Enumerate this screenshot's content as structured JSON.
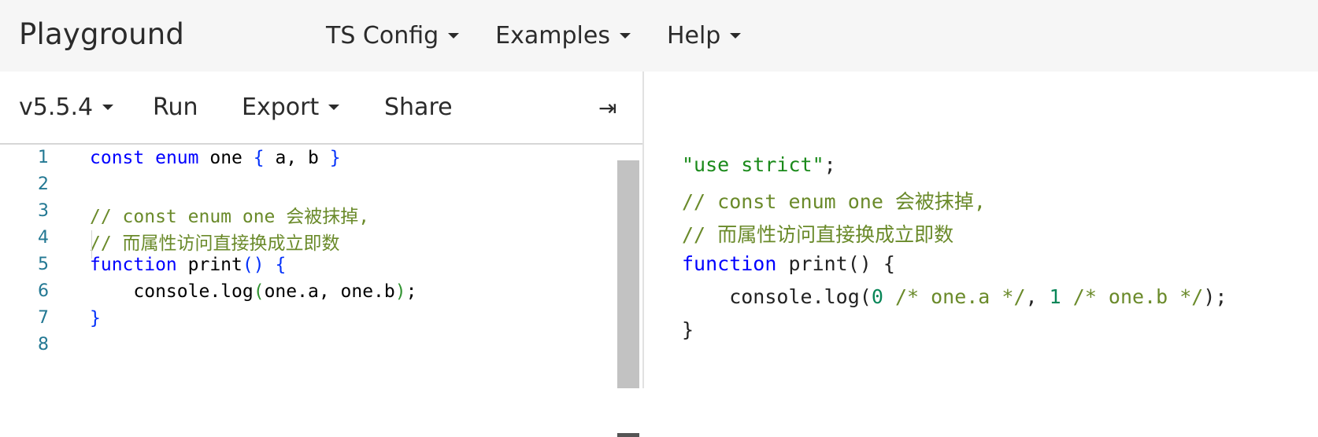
{
  "header": {
    "brand": "Playground",
    "nav": [
      {
        "label": "TS Config"
      },
      {
        "label": "Examples"
      },
      {
        "label": "Help"
      }
    ]
  },
  "toolbar": {
    "version": "v5.5.4",
    "run": "Run",
    "export": "Export",
    "share": "Share",
    "collapse_icon": "⇥"
  },
  "editor": {
    "line_numbers": [
      "1",
      "2",
      "3",
      "4",
      "5",
      "6",
      "7",
      "8"
    ],
    "lines": [
      {
        "tokens": [
          [
            "kw",
            "const"
          ],
          [
            "",
            " "
          ],
          [
            "kw",
            "enum"
          ],
          [
            "",
            " one "
          ],
          [
            "br",
            "{"
          ],
          [
            "",
            " a, b "
          ],
          [
            "br",
            "}"
          ]
        ]
      },
      {
        "tokens": []
      },
      {
        "tokens": [
          [
            "cm",
            "// const enum one 会被抹掉,"
          ]
        ]
      },
      {
        "tokens": [
          [
            "cm",
            "// 而属性访问直接换成立即数"
          ]
        ]
      },
      {
        "tokens": [
          [
            "kw",
            "function"
          ],
          [
            "",
            " print"
          ],
          [
            "br",
            "()"
          ],
          [
            "",
            " "
          ],
          [
            "br",
            "{"
          ]
        ]
      },
      {
        "tokens": [
          [
            "",
            "    console.log"
          ],
          [
            "br2",
            "("
          ],
          [
            "",
            "one.a, one.b"
          ],
          [
            "br2",
            ")"
          ],
          [
            "",
            ";"
          ]
        ]
      },
      {
        "tokens": [
          [
            "br",
            "}"
          ]
        ]
      },
      {
        "tokens": []
      }
    ]
  },
  "output": {
    "lines": [
      {
        "tokens": [
          [
            "str",
            "\"use strict\""
          ],
          [
            "",
            ";"
          ]
        ]
      },
      {
        "tokens": [
          [
            "ocm",
            "// const enum one 会被抹掉,"
          ]
        ]
      },
      {
        "tokens": [
          [
            "ocm",
            "// 而属性访问直接换成立即数"
          ]
        ]
      },
      {
        "tokens": [
          [
            "okw",
            "function"
          ],
          [
            "",
            " print() {"
          ]
        ]
      },
      {
        "tokens": [
          [
            "",
            "    console.log("
          ],
          [
            "num",
            "0"
          ],
          [
            "",
            " "
          ],
          [
            "ocm",
            "/* one.a */"
          ],
          [
            "",
            ", "
          ],
          [
            "num",
            "1"
          ],
          [
            "",
            " "
          ],
          [
            "ocm",
            "/* one.b */"
          ],
          [
            "",
            ");"
          ]
        ]
      },
      {
        "tokens": [
          [
            "",
            "}"
          ]
        ]
      }
    ]
  }
}
